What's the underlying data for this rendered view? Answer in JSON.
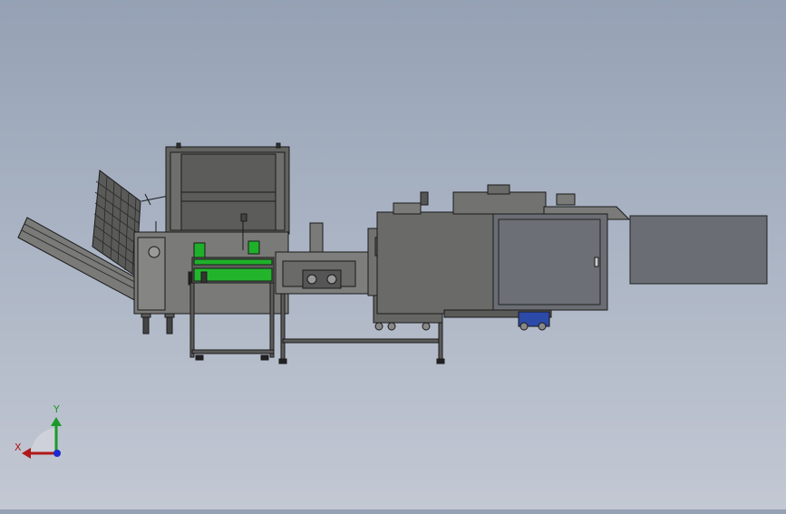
{
  "app": {
    "view": "cad-model-viewport"
  },
  "triad": {
    "y_label": "Y",
    "x_label": "X",
    "colors": {
      "x": "#b01818",
      "y": "#1a9a2a",
      "z": "#1a2ad0"
    }
  },
  "colors": {
    "machine_body": "#6e6e6c",
    "machine_dark": "#4a4a48",
    "edge": "#1a1a1a",
    "accent_green": "#1fb02a",
    "panel": "#6a6d73",
    "motor_blue": "#2c4aa8"
  }
}
